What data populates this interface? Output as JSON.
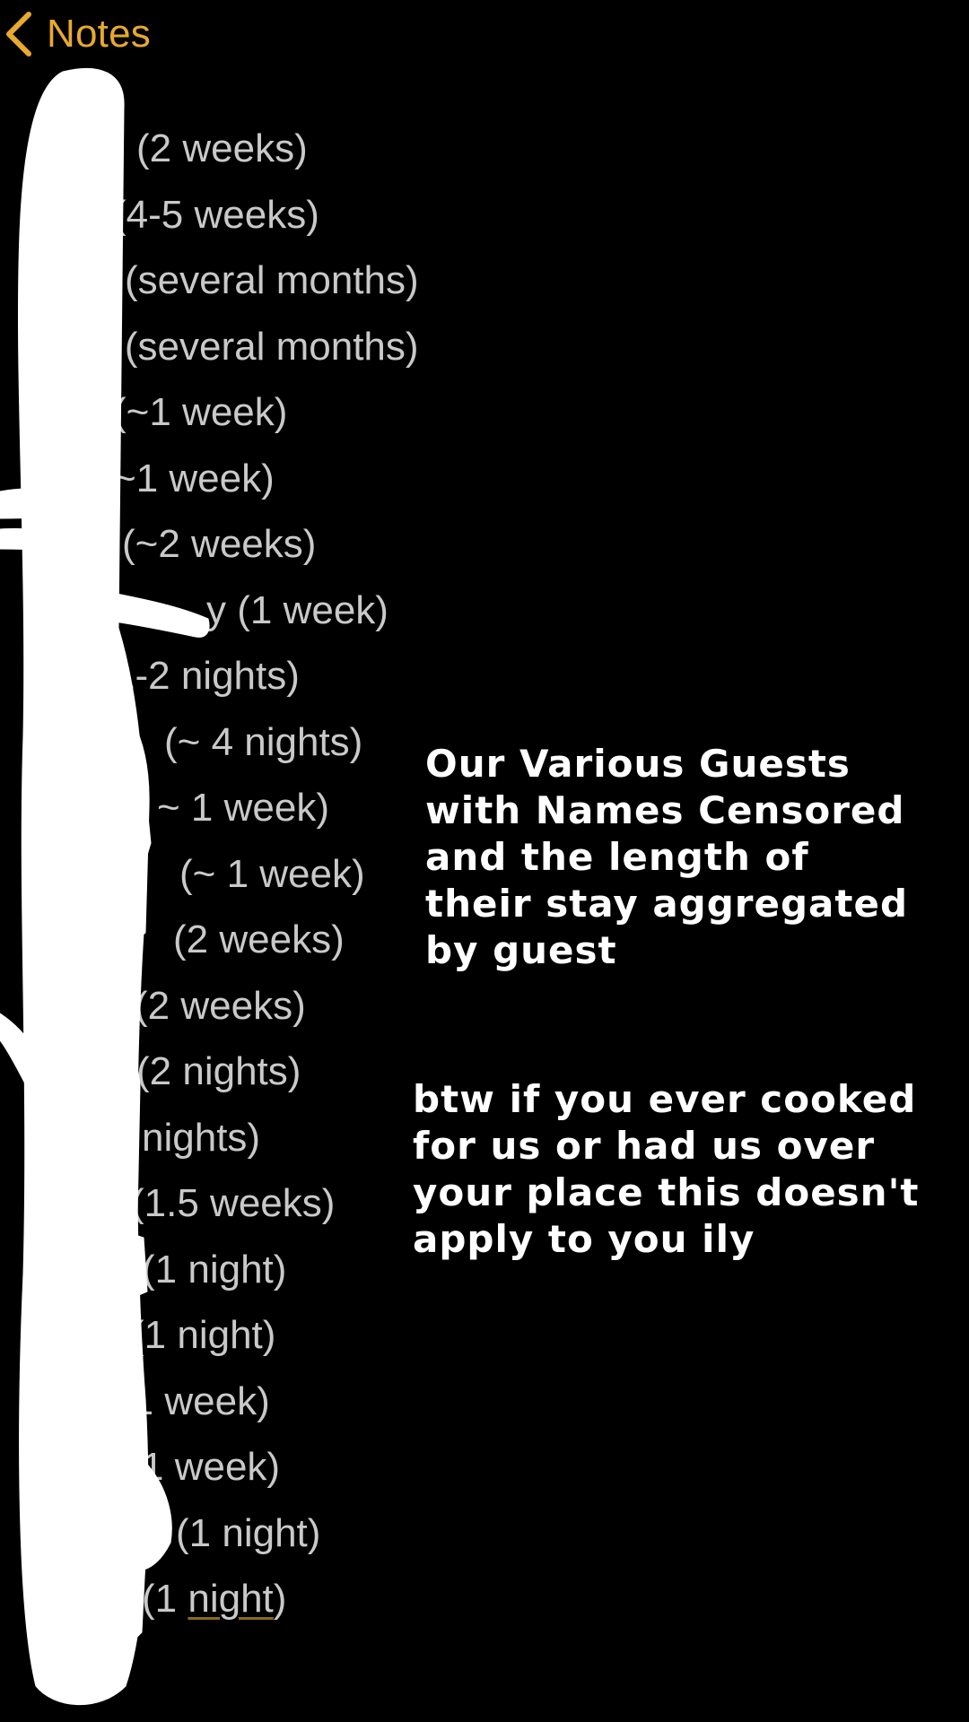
{
  "nav": {
    "back_label": "Notes",
    "back_icon": "chevron-left-icon",
    "accent_color": "#e8a92f"
  },
  "guest_list": [
    "(2 weeks)",
    "(4-5 weeks)",
    "(several months)",
    "r (several months)",
    "(~1 week)",
    "~1 week)",
    "(~2 weeks)",
    "y (1 week)",
    "1-2 nights)",
    "(~ 4 nights)",
    "~ 1 week)",
    "(~ 1 week)",
    "(2 weeks)",
    "(2 weeks)",
    "(2 nights)",
    "nights)",
    "(1.5 weeks)",
    "(1 night)",
    "(1 night)",
    "(1 week)",
    "1 week)",
    "(1 night)",
    {
      "before": "(1 ",
      "underlined": "night",
      "after": ")"
    }
  ],
  "caption_main": [
    "Our Various Guests",
    "with Names Censored",
    "and the length of",
    "their stay aggregated",
    "by guest"
  ],
  "caption_note": [
    "btw if you ever cooked",
    "for us or had us over",
    "your place this doesn't",
    "apply to you ily"
  ]
}
